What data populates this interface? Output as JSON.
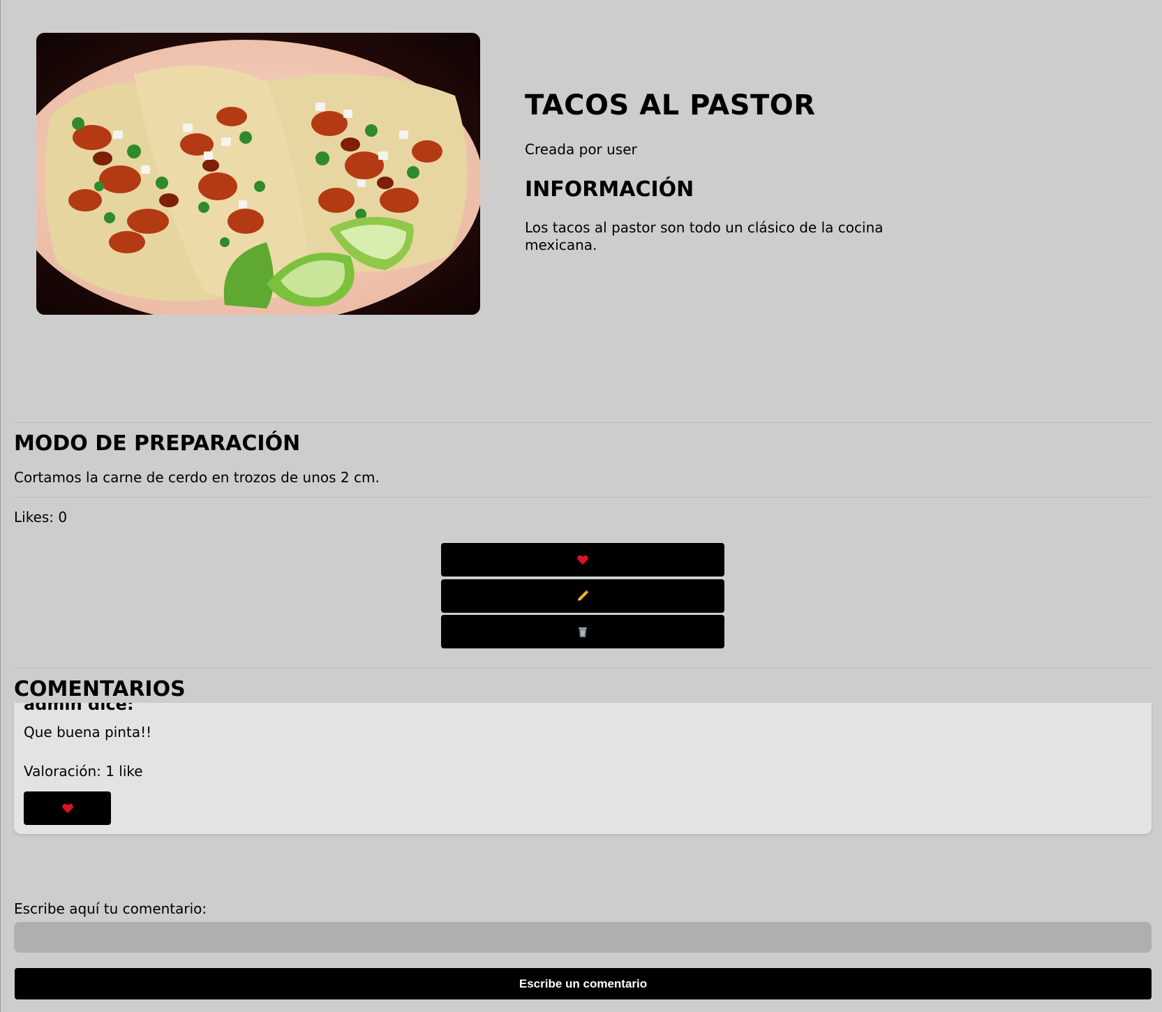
{
  "recipe": {
    "title": "TACOS AL PASTOR",
    "author_line": "Creada por user",
    "info_heading": "INFORMACIÓN",
    "info_text": "Los tacos al pastor son todo un clásico de la cocina mexicana."
  },
  "preparation": {
    "heading": "MODO DE PREPARACIÓN",
    "text": "Cortamos la carne de cerdo en trozos de unos 2 cm."
  },
  "likes": {
    "label": "Likes: 0"
  },
  "actions": [
    {
      "name": "like",
      "icon": "heart-icon"
    },
    {
      "name": "edit",
      "icon": "pencil-icon"
    },
    {
      "name": "delete",
      "icon": "trash-icon"
    }
  ],
  "comments": {
    "heading": "COMENTARIOS",
    "items": [
      {
        "author_line": "admin dice:",
        "text": "Que buena pinta!!",
        "rating": "Valoración: 1 like",
        "like_icon": "heart-icon"
      }
    ]
  },
  "new_comment": {
    "label": "Escribe aquí tu comentario:",
    "value": "",
    "placeholder": "",
    "submit_label": "Escribe un comentario"
  },
  "colors": {
    "background": "#cdcdcd",
    "button": "#000000",
    "heart": "#e0102a",
    "comment_card": "#e3e3e3",
    "input": "#afafaf"
  }
}
